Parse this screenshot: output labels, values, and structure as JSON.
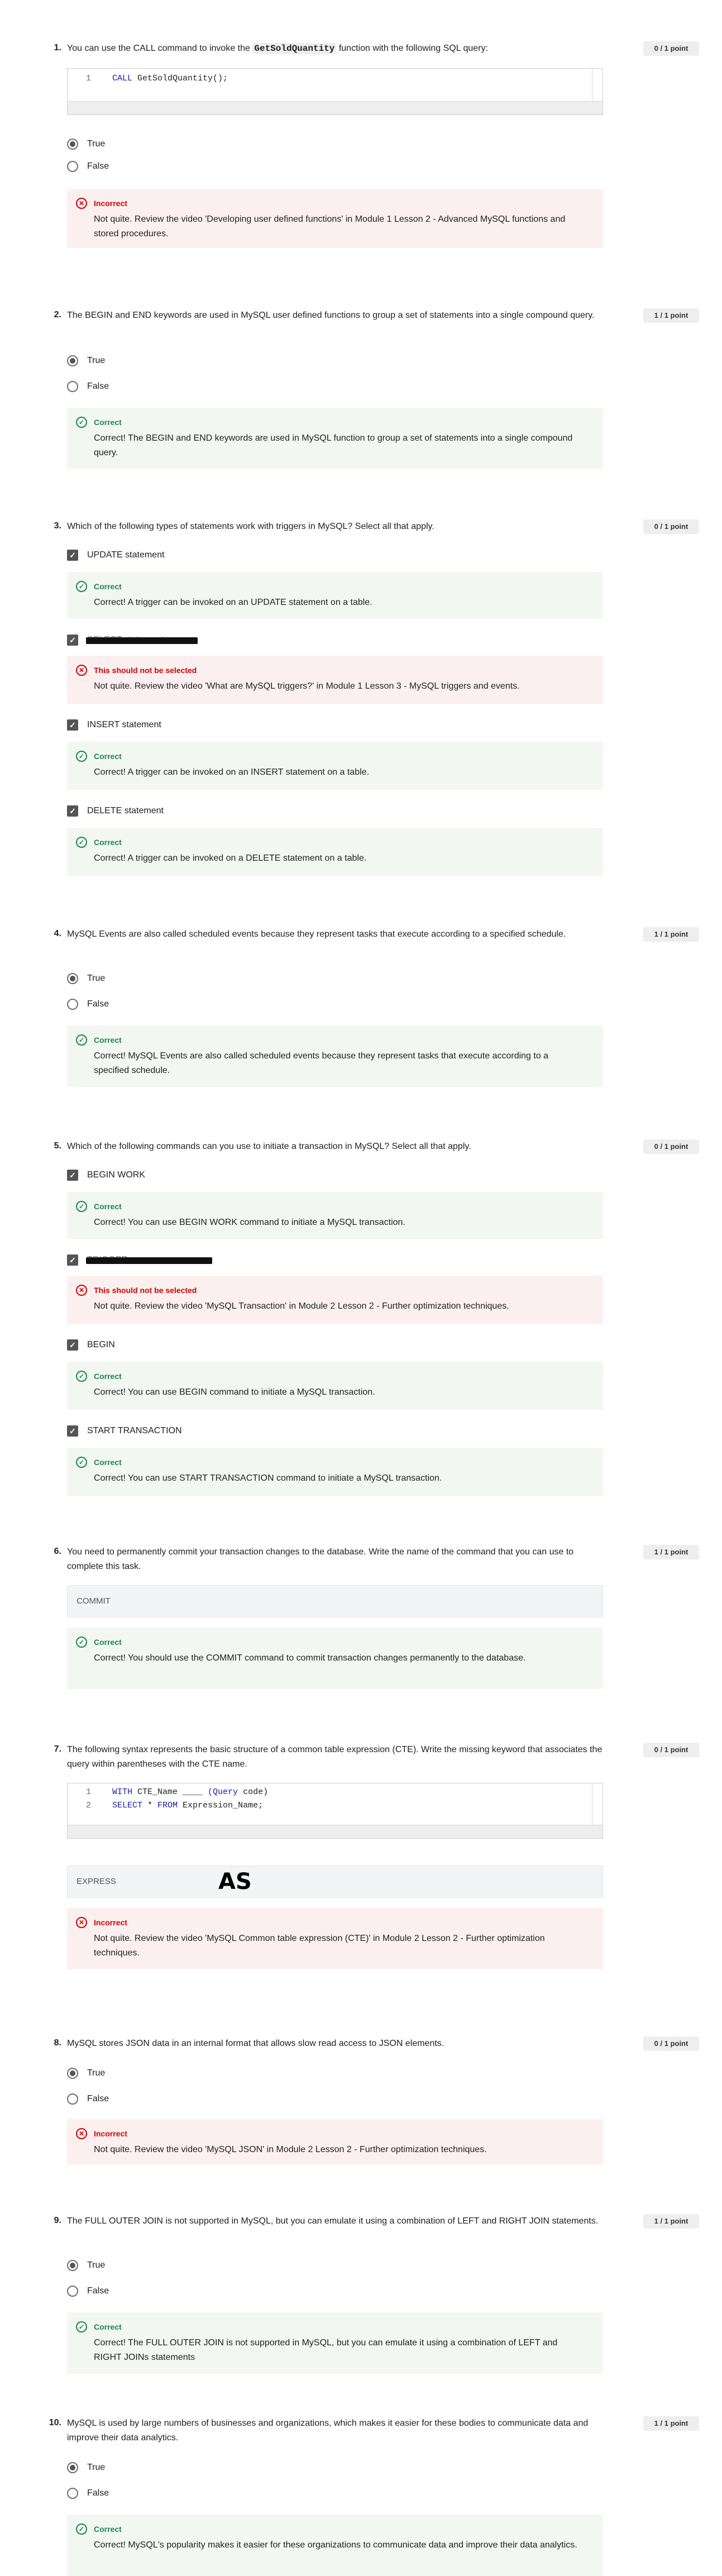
{
  "q1": {
    "num": "1.",
    "pre": "You can use the CALL command to invoke the ",
    "code": "GetSoldQuantity",
    "post": " function with the following SQL query:",
    "points": "0 / 1 point",
    "code_lines": [
      {
        "n": "1",
        "kw": "CALL",
        "rest": " GetSoldQuantity();"
      }
    ],
    "options": [
      "True",
      "False"
    ],
    "fb_title": "Incorrect",
    "fb_text": "Not quite. Review the video 'Developing user defined functions' in Module 1 Lesson 2 - Advanced MySQL functions and stored procedures."
  },
  "q2": {
    "num": "2.",
    "text": "The BEGIN and END keywords are used in MySQL user defined functions to group a set of statements into a single compound query.",
    "points": "1 / 1 point",
    "options": [
      "True",
      "False"
    ],
    "fb_title": "Correct",
    "fb_text": "Correct! The BEGIN and END keywords are used in MySQL function to group a set of statements into a single compound query."
  },
  "q3": {
    "num": "3.",
    "text": "Which of the following types of statements work with triggers in MySQL? Select all that apply.",
    "points": "0 / 1 point",
    "options": [
      "UPDATE statement",
      "SELECT statement",
      "INSERT statement",
      "DELETE statement"
    ],
    "fb": [
      {
        "title": "Correct",
        "text": "Correct! A trigger can be invoked on an UPDATE statement on a table."
      },
      {
        "title": "This should not be selected",
        "text": "Not quite. Review the video 'What are MySQL triggers?' in Module 1 Lesson 3 - MySQL triggers and events."
      },
      {
        "title": "Correct",
        "text": "Correct! A trigger can be invoked on an INSERT statement on a table."
      },
      {
        "title": "Correct",
        "text": "Correct! A trigger can be invoked on a DELETE statement on a table."
      }
    ]
  },
  "q4": {
    "num": "4.",
    "text": "MySQL Events are also called scheduled events because they represent tasks that execute according to a specified schedule.",
    "points": "1 / 1 point",
    "options": [
      "True",
      "False"
    ],
    "fb_title": "Correct",
    "fb_text": "Correct! MySQL Events are also called scheduled events because they represent tasks that execute according to a specified schedule."
  },
  "q5": {
    "num": "5.",
    "text": "Which of the following commands can you use to initiate a transaction in MySQL? Select all that apply.",
    "points": "0 / 1 point",
    "options": [
      "BEGIN WORK",
      "TRIGGER",
      "BEGIN",
      "START TRANSACTION"
    ],
    "fb": [
      {
        "title": "Correct",
        "text": "Correct! You can use BEGIN WORK command to initiate a MySQL transaction."
      },
      {
        "title": "This should not be selected",
        "text": "Not quite. Review the video 'MySQL Transaction' in Module 2 Lesson 2 - Further optimization techniques."
      },
      {
        "title": "Correct",
        "text": "Correct! You can use BEGIN command to initiate a MySQL transaction."
      },
      {
        "title": "Correct",
        "text": "Correct! You can use START TRANSACTION command to initiate a MySQL transaction."
      }
    ]
  },
  "q6": {
    "num": "6.",
    "text": "You need to permanently commit your transaction changes to the database. Write the name of the command that you can use to complete this task.",
    "points": "1 / 1 point",
    "answer": "COMMIT",
    "fb_title": "Correct",
    "fb_text": "Correct! You should use the COMMIT command to commit transaction changes permanently to the database."
  },
  "q7": {
    "num": "7.",
    "text": "The following syntax represents the basic structure of a common table expression (CTE). Write the missing keyword that associates the query within parentheses with the CTE name.",
    "points": "0 / 1 point",
    "code_lines": [
      {
        "n": "1",
        "kw": "WITH",
        "rest": " CTE_Name ____ ",
        "kw2": "(Query",
        "rest2": " code)"
      },
      {
        "n": "2",
        "kw": "SELECT",
        "rest": " * ",
        "kw2": "FROM",
        "rest2": " Expression_Name;"
      }
    ],
    "answer": "EXPRESS",
    "handwritten": "AS",
    "fb_title": "Incorrect",
    "fb_text": "Not quite. Review the video 'MySQL Common table expression (CTE)' in Module 2 Lesson 2 - Further optimization techniques."
  },
  "q8": {
    "num": "8.",
    "text": "MySQL stores JSON data in an internal format that allows slow read access to JSON elements.",
    "points": "0 / 1 point",
    "options": [
      "True",
      "False"
    ],
    "fb_title": "Incorrect",
    "fb_text": "Not quite. Review the video 'MySQL JSON' in Module 2 Lesson 2 - Further optimization techniques."
  },
  "q9": {
    "num": "9.",
    "text": "The FULL OUTER JOIN is not supported in MySQL, but you can emulate it using a combination of LEFT and RIGHT JOIN statements.",
    "points": "1 / 1 point",
    "options": [
      "True",
      "False"
    ],
    "fb_title": "Correct",
    "fb_text": "Correct! The FULL OUTER JOIN is not supported in MySQL, but you can emulate it using a combination of LEFT and RIGHT JOINs statements"
  },
  "q10": {
    "num": "10.",
    "text": "MySQL is used by large numbers of businesses and organizations, which makes it easier for these bodies to communicate data and improve their data analytics.",
    "points": "1 / 1 point",
    "options": [
      "True",
      "False"
    ],
    "fb_title": "Correct",
    "fb_text": "Correct! MySQL's popularity makes it easier for these organizations to communicate data and improve their data analytics."
  }
}
